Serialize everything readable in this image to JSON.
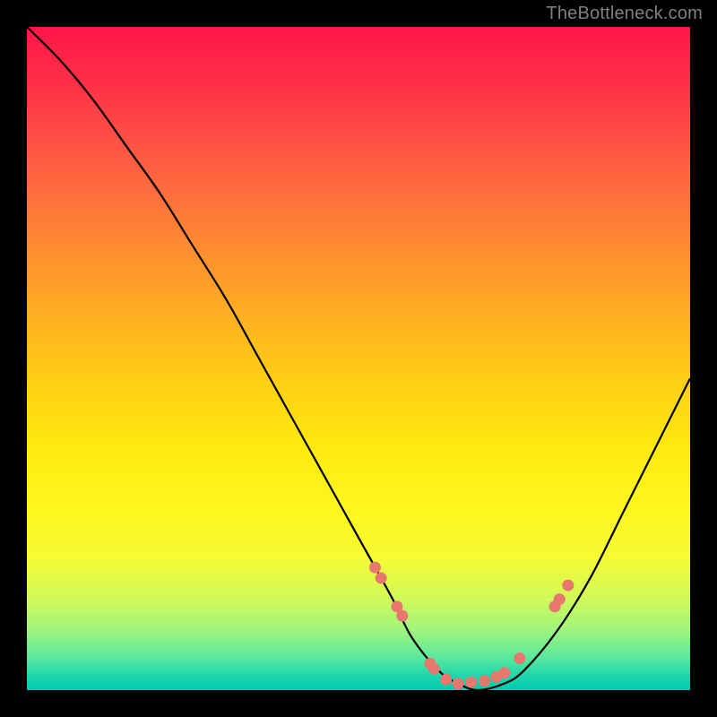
{
  "watermark": "TheBottleneck.com",
  "chart_data": {
    "type": "line",
    "title": "",
    "xlabel": "",
    "ylabel": "",
    "xlim": [
      0,
      100
    ],
    "ylim": [
      0,
      100
    ],
    "grid": false,
    "legend": false,
    "series": [
      {
        "name": "bottleneck-curve",
        "x": [
          0,
          5,
          10,
          15,
          20,
          25,
          30,
          35,
          40,
          45,
          50,
          55,
          58,
          62,
          65,
          68,
          72,
          75,
          80,
          85,
          90,
          95,
          100
        ],
        "y": [
          100,
          95,
          89,
          82,
          75,
          67,
          59,
          50,
          41,
          32,
          23,
          14,
          8,
          3,
          1,
          0,
          1,
          3,
          9,
          17,
          27,
          37,
          47
        ]
      }
    ],
    "markers": {
      "name": "highlighted-points",
      "color": "#e8786e",
      "x": [
        52.5,
        53.4,
        55.8,
        56.6,
        60.8,
        61.4,
        63.2,
        65.0,
        67.0,
        69.0,
        70.8,
        72.0,
        74.3,
        79.6,
        80.3,
        81.6
      ],
      "y": [
        18.5,
        16.9,
        12.6,
        11.2,
        4.0,
        3.2,
        1.6,
        1.0,
        1.2,
        1.4,
        2.0,
        2.6,
        4.8,
        12.6,
        13.7,
        15.8
      ]
    },
    "background_gradient": {
      "type": "vertical",
      "stops": [
        {
          "pos": 0.0,
          "color": "#ff1648"
        },
        {
          "pos": 0.4,
          "color": "#ffa326"
        },
        {
          "pos": 0.72,
          "color": "#fff61c"
        },
        {
          "pos": 0.91,
          "color": "#9ef47e"
        },
        {
          "pos": 1.0,
          "color": "#00cab2"
        }
      ]
    }
  }
}
